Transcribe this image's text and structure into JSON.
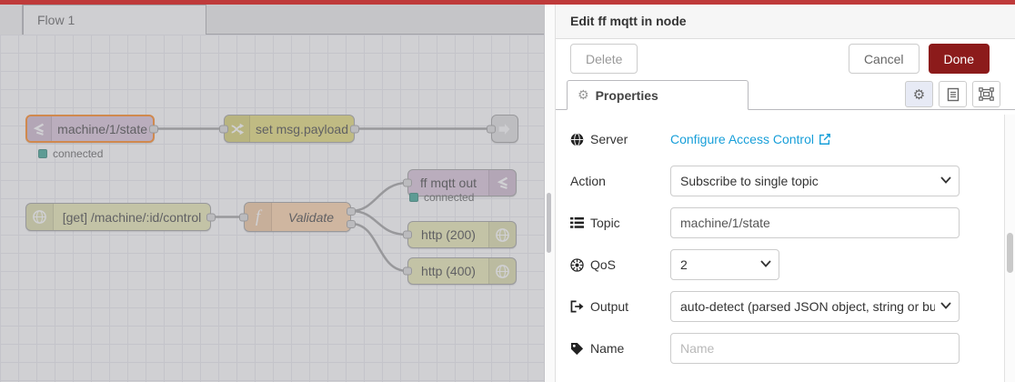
{
  "workspace": {
    "tab_label": "Flow 1",
    "nodes": [
      {
        "type": "mqtt in",
        "label": "machine/1/state",
        "status": "connected",
        "selected": true
      },
      {
        "type": "change",
        "label": "set msg.payload"
      },
      {
        "type": "link out",
        "label": ""
      },
      {
        "type": "http in",
        "label": "[get] /machine/:id/control"
      },
      {
        "type": "function",
        "label": "Validate"
      },
      {
        "type": "mqtt out",
        "label": "ff mqtt out",
        "status": "connected"
      },
      {
        "type": "http response",
        "label": "http (200)"
      },
      {
        "type": "http response",
        "label": "http (400)"
      }
    ]
  },
  "panel": {
    "title": "Edit ff mqtt in node",
    "buttons": {
      "delete": "Delete",
      "cancel": "Cancel",
      "done": "Done"
    },
    "tab_label": "Properties",
    "fields": {
      "server": {
        "label": "Server",
        "link": "Configure Access Control"
      },
      "action": {
        "label": "Action",
        "value": "Subscribe to single topic"
      },
      "topic": {
        "label": "Topic",
        "value": "machine/1/state"
      },
      "qos": {
        "label": "QoS",
        "value": "2"
      },
      "output": {
        "label": "Output",
        "value": "auto-detect (parsed JSON object, string or buffer)"
      },
      "name": {
        "label": "Name",
        "placeholder": "Name"
      }
    }
  },
  "colors": {
    "top_bar": "#bf3a3a",
    "done_button": "#8c1b1b",
    "link": "#189fd9",
    "selected_node_border": "#ff7f0e",
    "status_connected": "#2f9e8c",
    "node_mqtt": "#d8bfd8",
    "node_change": "#e2d96e",
    "node_http": "#e7e7ae",
    "node_function": "#fdd0a2",
    "node_link": "#dddddd"
  }
}
